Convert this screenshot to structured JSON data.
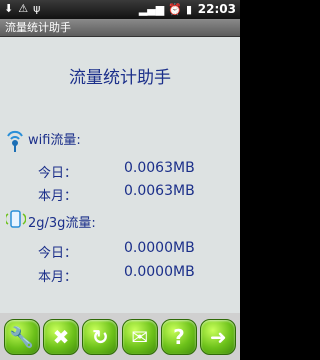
{
  "status": {
    "time": "22:03",
    "icons": [
      "download-icon",
      "warning-icon",
      "usb-icon",
      "signal-icon",
      "alarm-icon",
      "battery-icon"
    ]
  },
  "titlebar": {
    "title": "流量统计助手"
  },
  "main": {
    "heading": "流量统计助手",
    "wifi": {
      "label": "wifi流量:",
      "today_label": "今日：",
      "today_value": "0.0063MB",
      "month_label": "本月：",
      "month_value": "0.0063MB"
    },
    "mobile": {
      "label": "2g/3g流量:",
      "today_label": "今日：",
      "today_value": "0.0000MB",
      "month_label": "本月：",
      "month_value": "0.0000MB"
    }
  },
  "toolbar": {
    "buttons": [
      {
        "icon": "wrench-icon",
        "glyph": "🔧"
      },
      {
        "icon": "close-icon",
        "glyph": "✖"
      },
      {
        "icon": "refresh-icon",
        "glyph": "↻"
      },
      {
        "icon": "mail-icon",
        "glyph": "✉"
      },
      {
        "icon": "help-icon",
        "glyph": "?"
      },
      {
        "icon": "forward-arrow-icon",
        "glyph": "➜"
      }
    ]
  }
}
